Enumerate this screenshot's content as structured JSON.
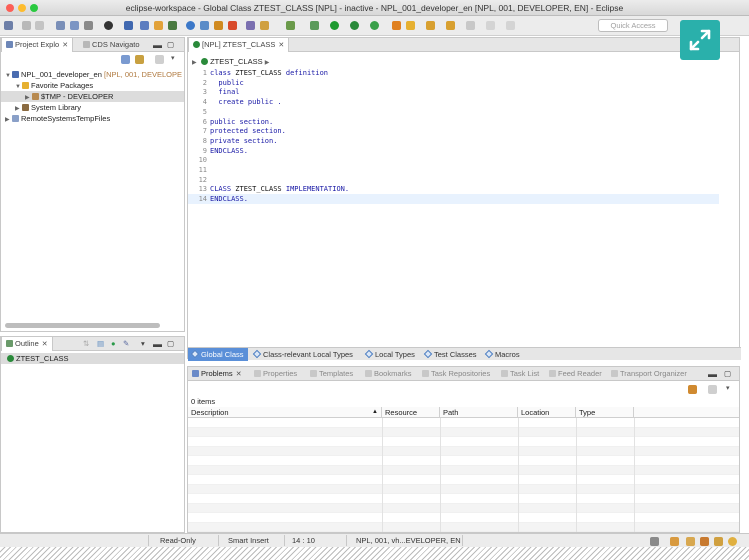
{
  "window": {
    "title": "eclipse-workspace - Global Class ZTEST_CLASS [NPL] - inactive - NPL_001_developer_en [NPL, 001, DEVELOPER, EN] - Eclipse"
  },
  "toolbar": {
    "quick_access_placeholder": "Quick Access"
  },
  "project_explorer": {
    "tabs": [
      {
        "label": "Project Explo"
      },
      {
        "label": "CDS Navigato"
      }
    ],
    "tree": {
      "project": {
        "name": "NPL_001_developer_en",
        "detail": "[NPL, 001, DEVELOPE"
      },
      "favorite_packages": "Favorite Packages",
      "tmp_package": "$TMP - DEVELOPER",
      "system_library": "System Library",
      "remote_files": "RemoteSystemsTempFiles"
    }
  },
  "outline": {
    "tab_label": "Outline",
    "items": [
      {
        "label": "ZTEST_CLASS"
      }
    ]
  },
  "editor": {
    "tab_label": "[NPL] ZTEST_CLASS",
    "breadcrumb": "ZTEST_CLASS",
    "lines": [
      {
        "num": "1",
        "tokens": [
          {
            "t": "class",
            "c": "kw"
          },
          {
            "t": " ZTEST_CLASS ",
            "c": "cls"
          },
          {
            "t": "definition",
            "c": "kw"
          }
        ]
      },
      {
        "num": "2",
        "tokens": [
          {
            "t": "  public",
            "c": "kw"
          }
        ]
      },
      {
        "num": "3",
        "tokens": [
          {
            "t": "  final",
            "c": "kw"
          }
        ]
      },
      {
        "num": "4",
        "tokens": [
          {
            "t": "  create public .",
            "c": "kw"
          }
        ]
      },
      {
        "num": "5",
        "tokens": []
      },
      {
        "num": "6",
        "tokens": [
          {
            "t": "public section.",
            "c": "kw"
          }
        ]
      },
      {
        "num": "7",
        "tokens": [
          {
            "t": "protected section.",
            "c": "kw"
          }
        ]
      },
      {
        "num": "8",
        "tokens": [
          {
            "t": "private section.",
            "c": "kw"
          }
        ]
      },
      {
        "num": "9",
        "tokens": [
          {
            "t": "ENDCLASS.",
            "c": "kw"
          }
        ]
      },
      {
        "num": "10",
        "tokens": []
      },
      {
        "num": "11",
        "tokens": []
      },
      {
        "num": "12",
        "tokens": []
      },
      {
        "num": "13",
        "tokens": [
          {
            "t": "CLASS",
            "c": "kw"
          },
          {
            "t": " ZTEST_CLASS ",
            "c": "cls"
          },
          {
            "t": "IMPLEMENTATION.",
            "c": "kw"
          }
        ]
      },
      {
        "num": "14",
        "tokens": [
          {
            "t": "ENDCLASS.",
            "c": "kw"
          }
        ]
      }
    ],
    "bottom_tabs": [
      {
        "label": "Global Class"
      },
      {
        "label": "Class-relevant Local Types"
      },
      {
        "label": "Local Types"
      },
      {
        "label": "Test Classes"
      },
      {
        "label": "Macros"
      }
    ]
  },
  "problems": {
    "tabs": [
      {
        "label": "Problems"
      },
      {
        "label": "Properties"
      },
      {
        "label": "Templates"
      },
      {
        "label": "Bookmarks"
      },
      {
        "label": "Task Repositories"
      },
      {
        "label": "Task List"
      },
      {
        "label": "Feed Reader"
      },
      {
        "label": "Transport Organizer"
      }
    ],
    "count": "0 items",
    "columns": [
      {
        "label": "Description"
      },
      {
        "label": "Resource"
      },
      {
        "label": "Path"
      },
      {
        "label": "Location"
      },
      {
        "label": "Type"
      }
    ]
  },
  "status_bar": {
    "mode": "Read-Only",
    "insert": "Smart Insert",
    "position": "14 : 10",
    "connection": "NPL, 001, vh...EVELOPER, EN"
  }
}
